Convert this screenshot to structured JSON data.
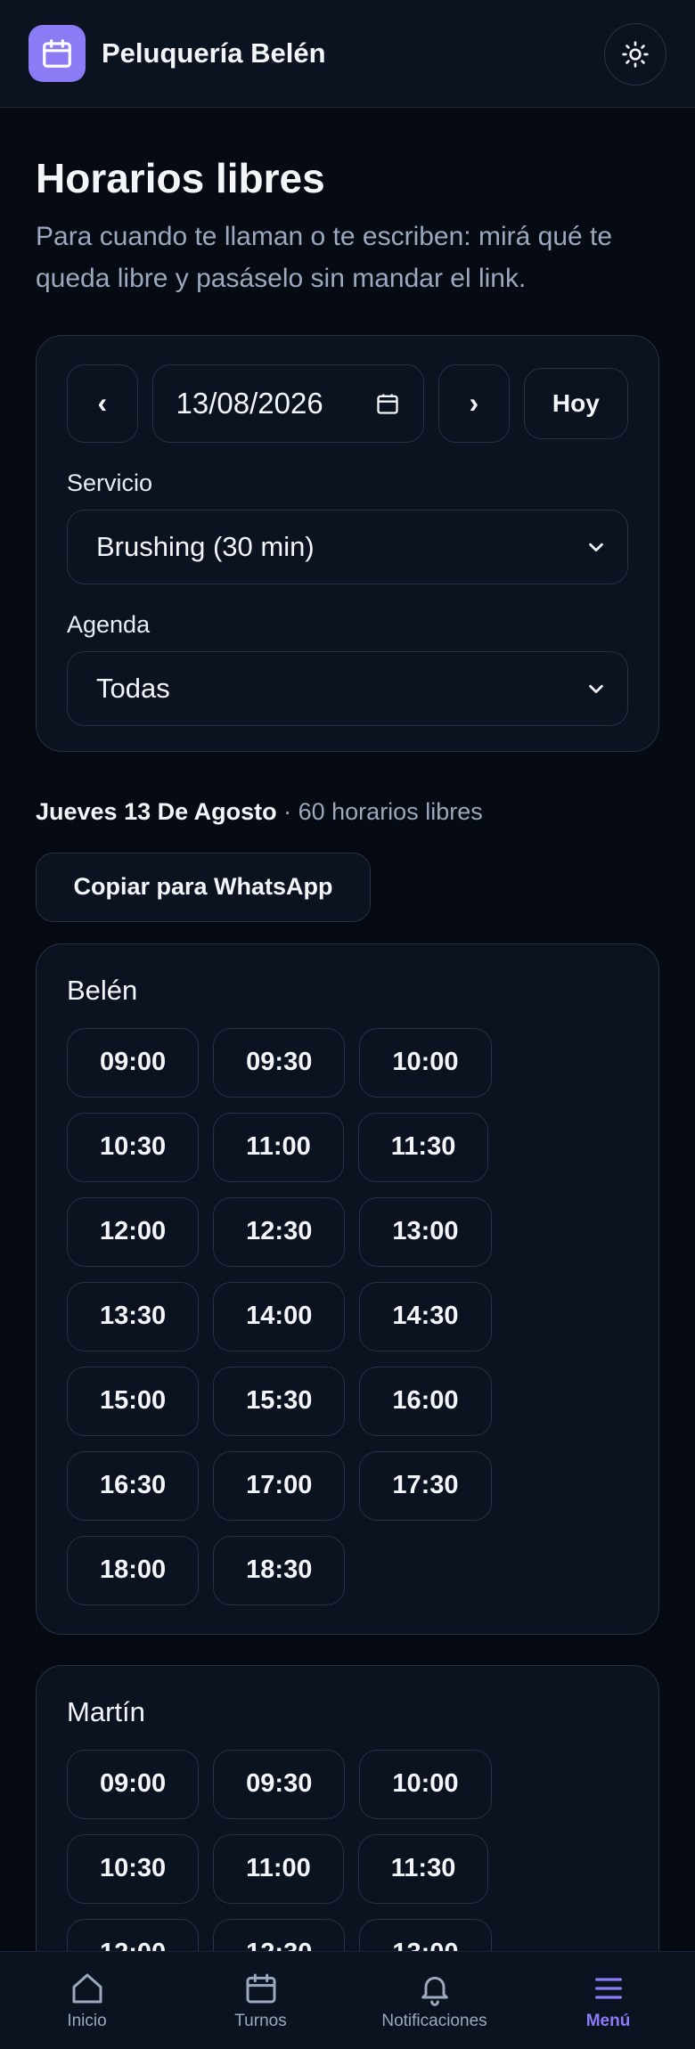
{
  "header": {
    "brand": "Peluquería Belén",
    "logo_icon": "calendar-icon",
    "theme_icon": "sun-icon"
  },
  "page": {
    "title": "Horarios libres",
    "subtitle": "Para cuando te llaman o te escriben: mirá qué te queda libre y pasáselo sin mandar el link."
  },
  "filters": {
    "prev_label": "‹",
    "next_label": "›",
    "date_value": "13/08/2026",
    "today_label": "Hoy",
    "service_label": "Servicio",
    "service_value": "Brushing (30 min)",
    "agenda_label": "Agenda",
    "agenda_value": "Todas"
  },
  "summary": {
    "day": "Jueves 13 De Agosto",
    "count": "· 60 horarios libres"
  },
  "copy_label": "Copiar para WhatsApp",
  "agendas": [
    {
      "name": "Belén",
      "slots": [
        "09:00",
        "09:30",
        "10:00",
        "10:30",
        "11:00",
        "11:30",
        "12:00",
        "12:30",
        "13:00",
        "13:30",
        "14:00",
        "14:30",
        "15:00",
        "15:30",
        "16:00",
        "16:30",
        "17:00",
        "17:30",
        "18:00",
        "18:30"
      ]
    },
    {
      "name": "Martín",
      "slots": [
        "09:00",
        "09:30",
        "10:00",
        "10:30",
        "11:00",
        "11:30",
        "12:00",
        "12:30",
        "13:00"
      ]
    }
  ],
  "bottom_nav": [
    {
      "label": "Inicio",
      "icon": "home-icon"
    },
    {
      "label": "Turnos",
      "icon": "calendar-icon"
    },
    {
      "label": "Notificaciones",
      "icon": "bell-icon"
    },
    {
      "label": "Menú",
      "icon": "menu-icon"
    }
  ],
  "colors": {
    "accent": "#8b7cf6",
    "background": "#050a13",
    "card": "#0b1220",
    "border": "#273144"
  }
}
